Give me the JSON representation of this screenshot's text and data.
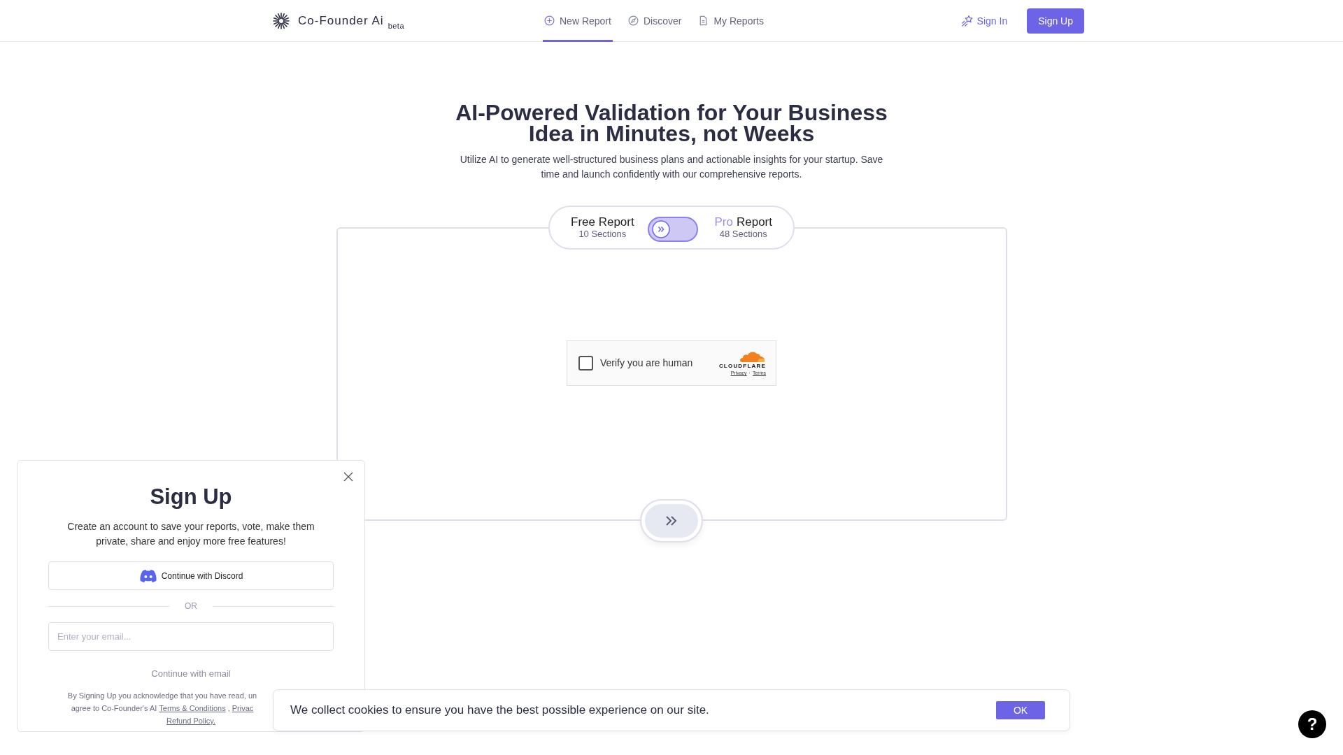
{
  "header": {
    "brand": "Co-Founder Ai",
    "brand_badge": "beta",
    "nav": [
      {
        "label": "New Report",
        "selected": true
      },
      {
        "label": "Discover",
        "selected": false
      },
      {
        "label": "My Reports",
        "selected": false
      }
    ],
    "sign_in": "Sign In",
    "sign_up": "Sign Up"
  },
  "hero": {
    "title_lines": [
      "AI-Powered Validation for Your Business",
      "Idea in Minutes, not Weeks"
    ],
    "subtitle_lines": [
      "Utilize AI to generate well-structured business plans and actionable insights for your startup. Save",
      "time and launch confidently with our comprehensive reports."
    ]
  },
  "report_toggle": {
    "on": false,
    "options": [
      {
        "title": "Free Report",
        "sections": "10 Sections"
      },
      {
        "accent": "Pro",
        "title": "Report",
        "sections": "48 Sections"
      }
    ]
  },
  "captcha": {
    "checked": false,
    "label": "Verify you are human",
    "brand": "CLOUDFLARE",
    "links": [
      "Privacy",
      "Terms"
    ],
    "separator": "·"
  },
  "signup_panel": {
    "title": "Sign Up",
    "description_lines": [
      "Create an account to save your reports, vote, make them",
      "private, share and enjoy more free features!"
    ],
    "discord_button": "Continue with Discord",
    "divider": "OR",
    "email_placeholder": "Enter your email...",
    "email_button": "Continue with email",
    "legal_line_1": "By Signing Up you acknowledge that you have read, un",
    "legal_line_2_prefix": "agree to Co-Founder's AI",
    "legal_links": [
      "Terms & Conditions",
      "Privac"
    ],
    "legal_sep": ",",
    "legal_line_3": "Refund Policy."
  },
  "cookie_banner": {
    "message": "We collect cookies to ensure you have the best possible experience on our site.",
    "button": "OK"
  },
  "help_button": "?"
}
